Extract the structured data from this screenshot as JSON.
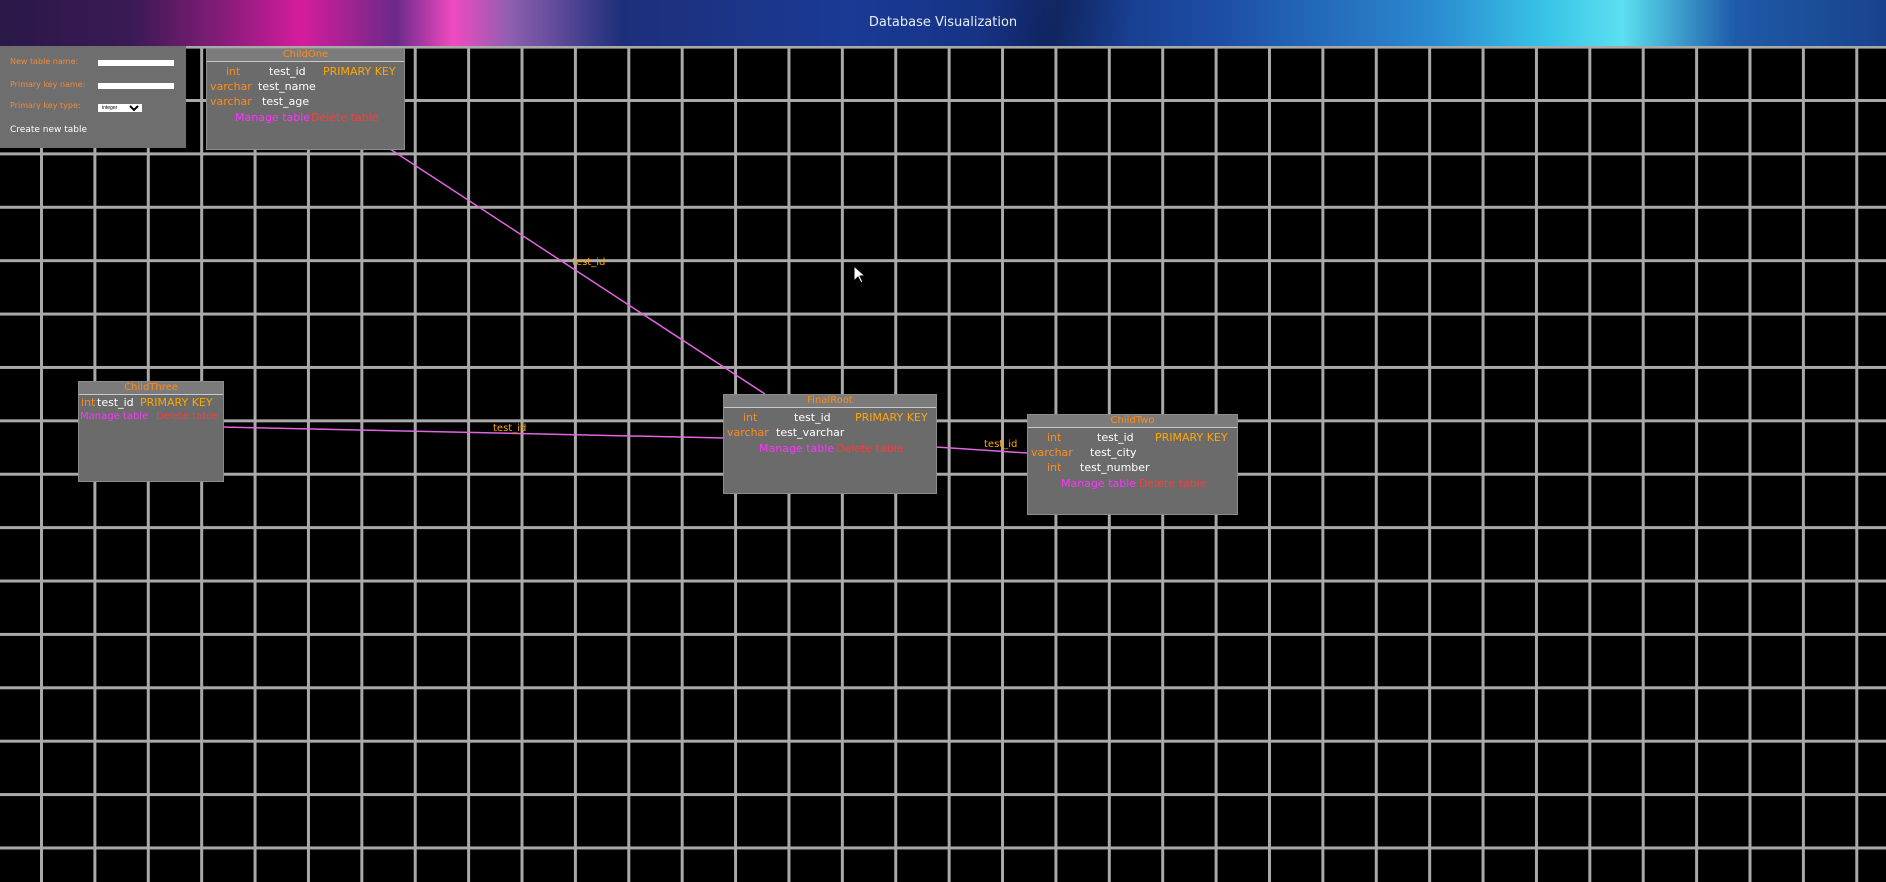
{
  "window": {
    "title": "Database Visualization"
  },
  "create_panel": {
    "table_name_label": "New table name:",
    "table_name_value": "",
    "pk_name_label": "Primary key name:",
    "pk_name_value": "",
    "pk_type_label": "Primary key type:",
    "pk_type_value": "integer",
    "create_label": "Create new table"
  },
  "tables": {
    "child_one": {
      "name": "ChildOne",
      "fields": [
        {
          "type": "int",
          "name": "test_id",
          "key": "PRIMARY KEY"
        },
        {
          "type": "varchar",
          "name": "test_name"
        },
        {
          "type": "varchar",
          "name": "test_age"
        }
      ],
      "manage_label": "Manage table",
      "delete_label": "Delete table"
    },
    "child_three": {
      "name": "ChildThree",
      "fields": [
        {
          "type": "int",
          "name": "test_id",
          "key": "PRIMARY KEY"
        }
      ],
      "manage_label": "Manage table",
      "delete_label": "Delete table"
    },
    "final_root": {
      "name": "FinalRoot",
      "fields": [
        {
          "type": "int",
          "name": "test_id",
          "key": "PRIMARY KEY"
        },
        {
          "type": "varchar",
          "name": "test_varchar"
        }
      ],
      "manage_label": "Manage table",
      "delete_label": "Delete table"
    },
    "child_two": {
      "name": "ChildTwo",
      "fields": [
        {
          "type": "int",
          "name": "test_id",
          "key": "PRIMARY KEY"
        },
        {
          "type": "varchar",
          "name": "test_city"
        },
        {
          "type": "int",
          "name": "test_number"
        }
      ],
      "manage_label": "Manage table",
      "delete_label": "Delete table"
    }
  },
  "relations": {
    "one_to_root": "test_id",
    "three_to_root": "test_id",
    "root_to_two": "test_id"
  },
  "colors": {
    "grid_line": "#a9a9a9",
    "table_bg": "#6b6b6b",
    "table_title": "#ff8c1a",
    "relation_line": "#e066e0",
    "primary_key": "#ffa800",
    "manage": "#ff33ff",
    "delete": "#ff3b3b"
  }
}
